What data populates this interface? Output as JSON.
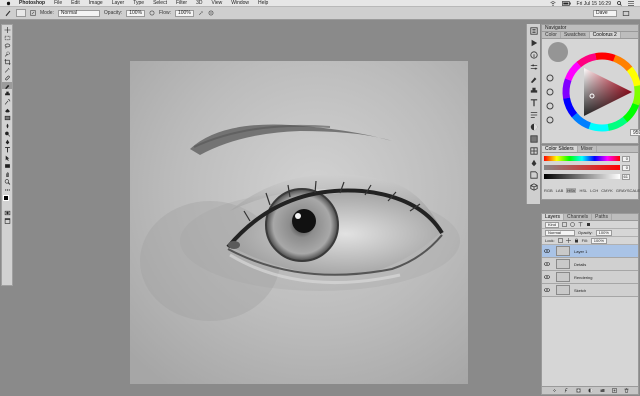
{
  "menubar": {
    "app_name": "Photoshop",
    "items": [
      "File",
      "Edit",
      "Image",
      "Layer",
      "Type",
      "Select",
      "Filter",
      "3D",
      "View",
      "Window",
      "Help"
    ],
    "clock": "Fri Jul 15  16:29",
    "user": "Dave"
  },
  "options": {
    "mode_label": "Mode:",
    "mode_value": "Normal",
    "opacity_label": "Opacity:",
    "opacity_value": "100%",
    "flow_label": "Flow:",
    "flow_value": "100%",
    "workspace_value": "Dave"
  },
  "panels": {
    "navigator": {
      "title": "Navigator"
    },
    "color_tabs": [
      "Color",
      "Swatches",
      "Coolorus 2"
    ],
    "color_tab_active": 2,
    "hex_value": "959595",
    "sliders_tabs": [
      "Color Sliders",
      "Mixer"
    ],
    "slider_values": [
      "0",
      "0",
      "61"
    ],
    "modes": [
      "RGB",
      "LAB",
      "HSV",
      "HSL",
      "LCH",
      "CMYK",
      "GRAYSCALE"
    ],
    "mode_active": 2,
    "layers_tabs": [
      "Layers",
      "Channels",
      "Paths"
    ],
    "layers_kind": "Kind",
    "layers_blend": "Normal",
    "layers_opacity_label": "Opacity:",
    "layers_opacity": "100%",
    "layers_lock_label": "Lock:",
    "layers_fill_label": "Fill:",
    "layers_fill": "100%",
    "layers": [
      {
        "name": "Layer 1",
        "selected": true
      },
      {
        "name": "Details",
        "selected": false
      },
      {
        "name": "Rendering",
        "selected": false
      },
      {
        "name": "Sketch",
        "selected": false
      }
    ]
  },
  "colors": {
    "accent_selection": "#a9c3e6",
    "foreground": "#000000",
    "background": "#ffffff"
  }
}
